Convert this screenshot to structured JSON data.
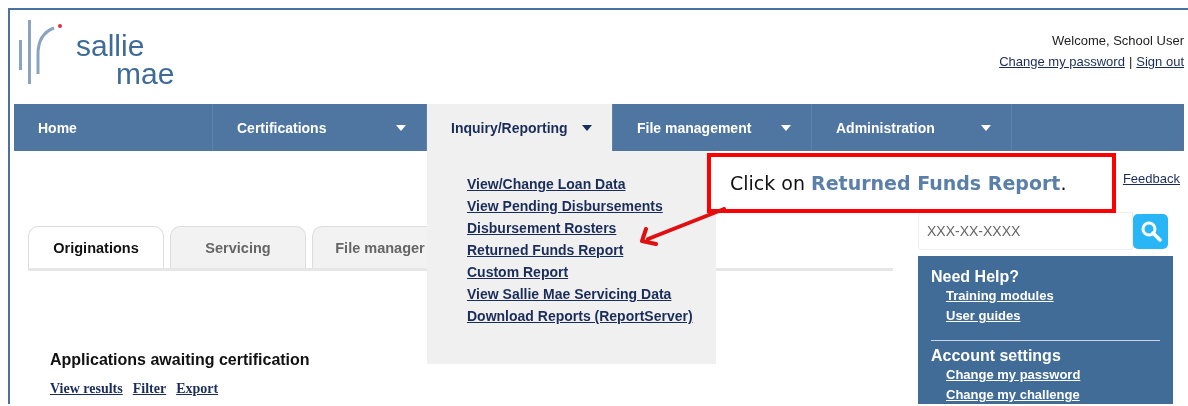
{
  "logo": {
    "line_1": "sallie",
    "line_2": "mae"
  },
  "user": {
    "welcome": "Welcome, School User",
    "links": [
      "Change my password",
      "Sign out"
    ],
    "separator": "|"
  },
  "nav": [
    {
      "label": "Home",
      "has_menu": false,
      "selected": false
    },
    {
      "label": "Certifications",
      "has_menu": true,
      "selected": false
    },
    {
      "label": "Inquiry/Reporting",
      "has_menu": true,
      "selected": true
    },
    {
      "label": "File management",
      "has_menu": true,
      "selected": false
    },
    {
      "label": "Administration",
      "has_menu": true,
      "selected": false
    }
  ],
  "dropdown": {
    "items": [
      "View/Change Loan Data",
      "View Pending Disbursements",
      "Disbursement Rosters",
      "Returned Funds Report",
      "Custom Report",
      "View Sallie Mae Servicing Data",
      "Download Reports (ReportServer)"
    ]
  },
  "tabs": [
    {
      "label": "Originations",
      "selected": true
    },
    {
      "label": "Servicing",
      "selected": false
    },
    {
      "label": "File manager",
      "selected": false
    }
  ],
  "section": {
    "title": "Applications awaiting certification",
    "links": [
      "View results",
      "Filter",
      "Export"
    ]
  },
  "feedback": "Feedback",
  "search": {
    "placeholder": "XXX-XX-XXXX"
  },
  "help_panel": {
    "groups": [
      {
        "title": "Need Help?",
        "links": [
          "Training modules",
          "User guides"
        ]
      },
      {
        "title": "Account settings",
        "links": [
          "Change my password",
          "Change my challenge"
        ]
      }
    ]
  },
  "callout": {
    "text": "Click on **Returned Funds Report**."
  }
}
